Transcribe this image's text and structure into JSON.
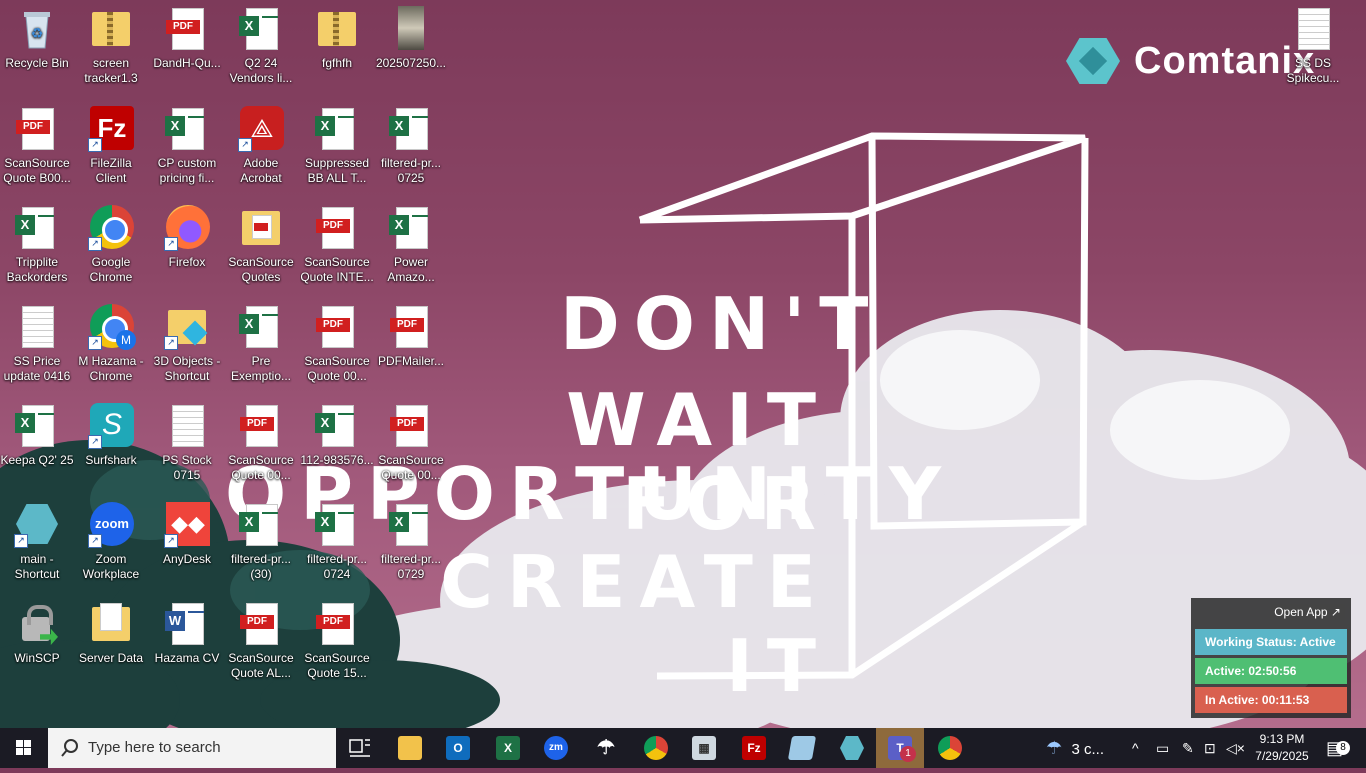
{
  "desktop": {
    "icons": [
      {
        "label": "Recycle Bin"
      },
      {
        "label": "screen tracker1.3"
      },
      {
        "label": "DandH-Qu..."
      },
      {
        "label": "Q2 24 Vendors li..."
      },
      {
        "label": "fgfhfh"
      },
      {
        "label": "202507250..."
      },
      {
        "label": "ScanSource Quote B00..."
      },
      {
        "label": "FileZilla Client"
      },
      {
        "label": "CP custom pricing fi..."
      },
      {
        "label": "Adobe Acrobat"
      },
      {
        "label": "Suppressed BB ALL T..."
      },
      {
        "label": "filtered-pr... 0725"
      },
      {
        "label": "Tripplite Backorders"
      },
      {
        "label": "Google Chrome"
      },
      {
        "label": "Firefox"
      },
      {
        "label": "ScanSource Quotes"
      },
      {
        "label": "ScanSource Quote INTE..."
      },
      {
        "label": "Power Amazo..."
      },
      {
        "label": "SS Price update 0416"
      },
      {
        "label": "M Hazama - Chrome"
      },
      {
        "label": "3D Objects - Shortcut"
      },
      {
        "label": "Pre Exemptio..."
      },
      {
        "label": "ScanSource Quote 00..."
      },
      {
        "label": "PDFMailer..."
      },
      {
        "label": "Keepa Q2' 25"
      },
      {
        "label": "Surfshark"
      },
      {
        "label": "PS Stock 0715"
      },
      {
        "label": "ScanSource Quote 00..."
      },
      {
        "label": "112-983576..."
      },
      {
        "label": "ScanSource Quote 00..."
      },
      {
        "label": "main - Shortcut"
      },
      {
        "label": "Zoom Workplace"
      },
      {
        "label": "AnyDesk"
      },
      {
        "label": "filtered-pr... (30)"
      },
      {
        "label": "filtered-pr... 0724"
      },
      {
        "label": "filtered-pr... 0729"
      },
      {
        "label": "WinSCP"
      },
      {
        "label": "Server Data"
      },
      {
        "label": "Hazama CV"
      },
      {
        "label": "ScanSource Quote AL..."
      },
      {
        "label": "ScanSource Quote 15..."
      },
      {
        "label": "SS DS Spikecu..."
      }
    ]
  },
  "wallpaper": {
    "brand": "Comtanix",
    "quote_lines": [
      "DON'T",
      "WAIT FOR",
      "OPPORTUNITY",
      "CREATE IT"
    ]
  },
  "tracker_widget": {
    "open_app": "Open App ↗",
    "status": "Working Status: Active",
    "active": "Active: 02:50:56",
    "inactive": "In Active: 00:11:53"
  },
  "taskbar": {
    "search_placeholder": "Type here to search",
    "weather": "3 c...",
    "time": "9:13 PM",
    "date": "7/29/2025",
    "notification_count": "8",
    "teams_badge": "1"
  },
  "colors": {
    "widget_status": "#5bb6c8",
    "widget_active": "#4fbf73",
    "widget_inactive": "#d9604f",
    "taskbar": "#1b1b24"
  }
}
